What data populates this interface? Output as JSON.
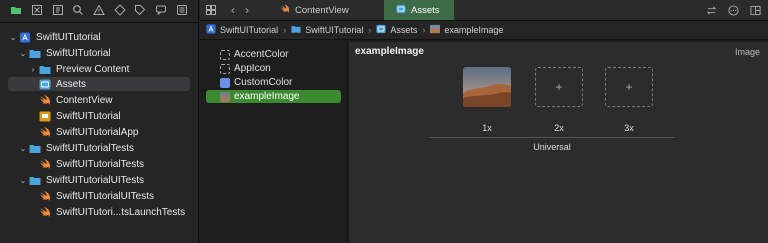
{
  "navigator": {
    "toolbar_icons": [
      "folder-icon",
      "x-square-icon",
      "hierarchy-icon",
      "search-icon",
      "warning-icon",
      "diamond-icon",
      "tag-icon",
      "speech-icon",
      "list-icon"
    ],
    "tree": [
      {
        "label": "SwiftUITutorial",
        "icon": "project-icon",
        "expanded": true,
        "depth": 0
      },
      {
        "label": "SwiftUITutorial",
        "icon": "folder-icon",
        "expanded": true,
        "depth": 1
      },
      {
        "label": "Preview Content",
        "icon": "folder-icon",
        "expanded": false,
        "depth": 2
      },
      {
        "label": "Assets",
        "icon": "asset-catalog-icon",
        "depth": 2,
        "selected": true
      },
      {
        "label": "ContentView",
        "icon": "swift-file-icon",
        "depth": 2
      },
      {
        "label": "SwiftUITutorial",
        "icon": "entitlements-icon",
        "depth": 2
      },
      {
        "label": "SwiftUITutorialApp",
        "icon": "swift-file-icon",
        "depth": 2
      },
      {
        "label": "SwiftUITutorialTests",
        "icon": "folder-icon",
        "expanded": true,
        "depth": 1
      },
      {
        "label": "SwiftUITutorialTests",
        "icon": "swift-file-icon",
        "depth": 2
      },
      {
        "label": "SwiftUITutorialUITests",
        "icon": "folder-icon",
        "expanded": true,
        "depth": 1
      },
      {
        "label": "SwiftUITutorialUITests",
        "icon": "swift-file-icon",
        "depth": 2
      },
      {
        "label": "SwiftUITutori...tsLaunchTests",
        "icon": "swift-file-icon",
        "depth": 2
      }
    ]
  },
  "tabs": [
    {
      "label": "ContentView",
      "icon": "swift-file-icon",
      "active": false
    },
    {
      "label": "Assets",
      "icon": "asset-catalog-icon",
      "active": true
    }
  ],
  "jumpbar": [
    "SwiftUITutorial",
    "SwiftUITutorial",
    "Assets",
    "exampleImage"
  ],
  "assets": [
    {
      "label": "AccentColor",
      "kind": "empty"
    },
    {
      "label": "AppIcon",
      "kind": "empty"
    },
    {
      "label": "CustomColor",
      "kind": "color"
    },
    {
      "label": "exampleImage",
      "kind": "image",
      "selected": true
    }
  ],
  "image_set": {
    "name": "exampleImage",
    "kind_label": "Image",
    "slots": [
      {
        "label": "1x",
        "filled": true
      },
      {
        "label": "2x",
        "filled": false,
        "placeholder": "+"
      },
      {
        "label": "3x",
        "filled": false,
        "placeholder": "+"
      }
    ],
    "group_label": "Universal"
  },
  "colors": {
    "active_tab": "#3d6b47",
    "selected_asset": "#3b8a2f",
    "swift_orange": "#f0883e",
    "folder_blue": "#4aa3df",
    "custom_color": "#6b8ee6"
  }
}
